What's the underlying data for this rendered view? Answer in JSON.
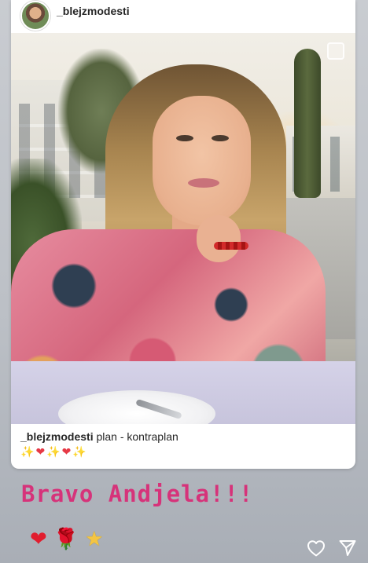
{
  "post": {
    "username": "_blejzmodesti",
    "caption_user": "_blejzmodesti",
    "caption_text": " plan - kontraplan",
    "caption_emoji": [
      "✨",
      "❤",
      "✨",
      "❤",
      "✨"
    ]
  },
  "story": {
    "text": "Bravo Andjela!!!",
    "reactions": [
      "❤",
      "🌹",
      "★"
    ]
  },
  "icons": {
    "like": "heart-outline-icon",
    "send": "send-icon"
  },
  "colors": {
    "story_text": "#d6337a",
    "background": "#c9ccd1"
  }
}
